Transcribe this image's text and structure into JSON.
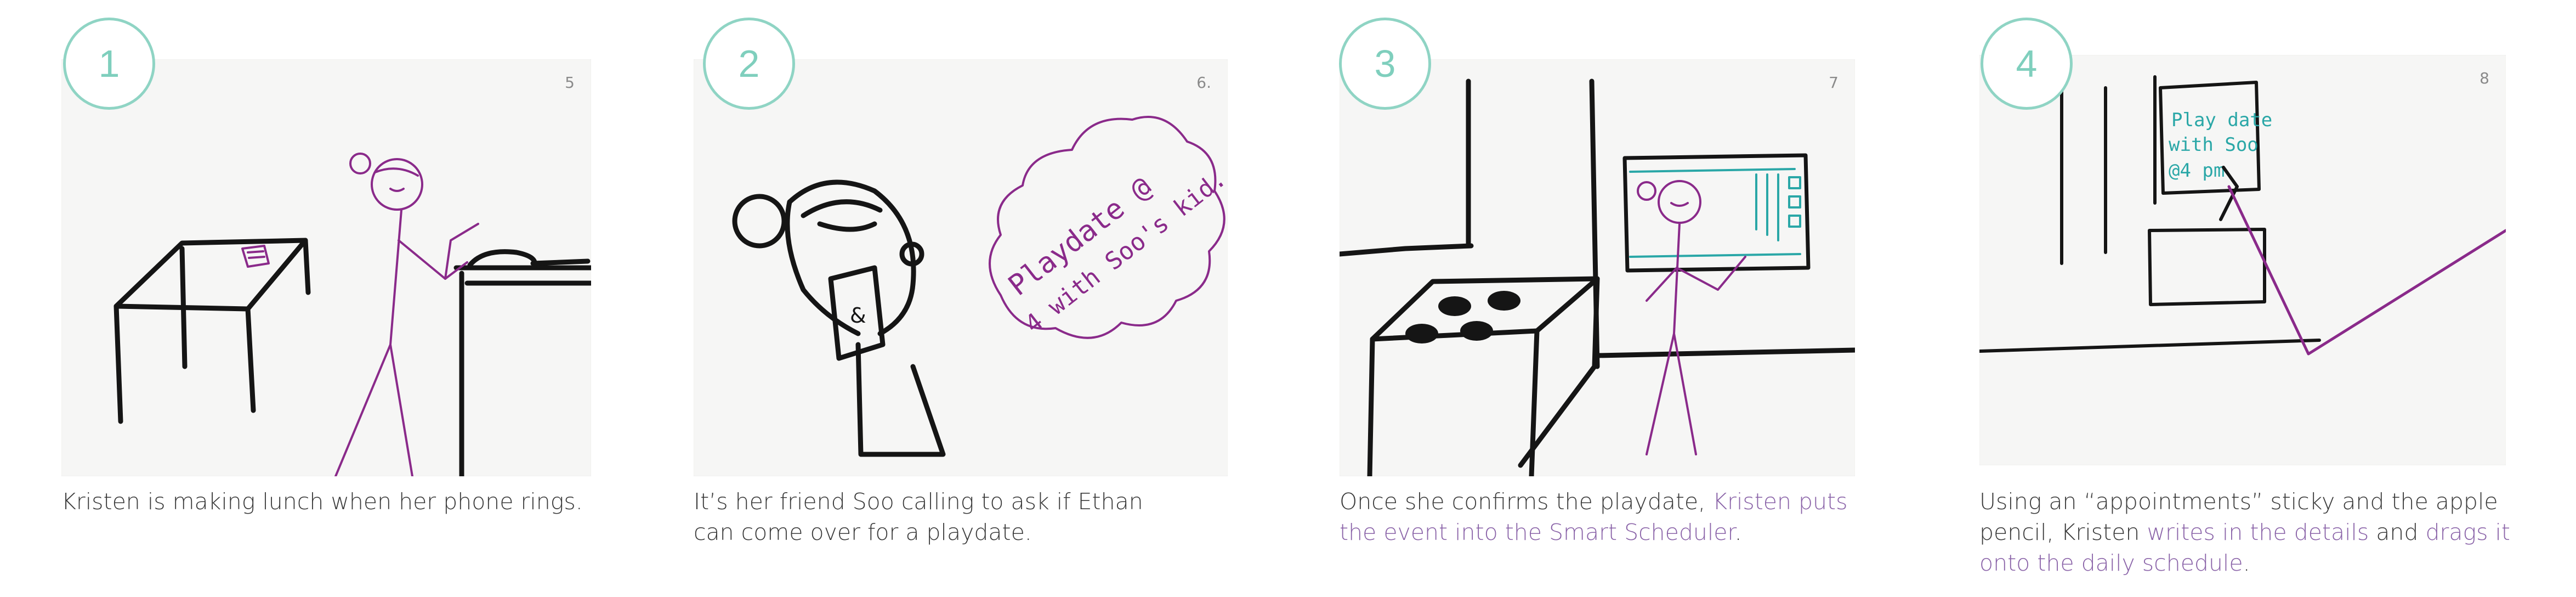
{
  "panels": [
    {
      "number": "1",
      "page_mark": "5",
      "caption": {
        "text": "Kristen is making lunch when her phone rings."
      }
    },
    {
      "number": "2",
      "page_mark": "6.",
      "bubble_text": [
        "Playdate @",
        "4 with Soo's kid."
      ],
      "phone_mark": "&",
      "caption": {
        "text": "It’s her friend Soo calling to ask if Ethan can come over for a playdate."
      }
    },
    {
      "number": "3",
      "page_mark": "7",
      "caption": {
        "plain": "Once she confirms the playdate, ",
        "highlight": "Kristen puts the event into the Smart Scheduler",
        "end": "."
      }
    },
    {
      "number": "4",
      "page_mark": "8",
      "note_text": [
        "Play date",
        "with Soo",
        "@4 pm"
      ],
      "caption": {
        "plain1": "Using an “appointments” sticky and the apple pencil, Kristen ",
        "highlight1": "writes in the details",
        "plain2": " and ",
        "highlight2": "drags it onto the daily schedule",
        "end": "."
      }
    }
  ],
  "colors": {
    "badge": "#8fd4c4",
    "highlight": "#8a63a8",
    "caption": "#3a3a3a",
    "sketch_ink": "#151515",
    "sketch_purple": "#8a2a8a",
    "sketch_teal": "#2aa7a7"
  }
}
